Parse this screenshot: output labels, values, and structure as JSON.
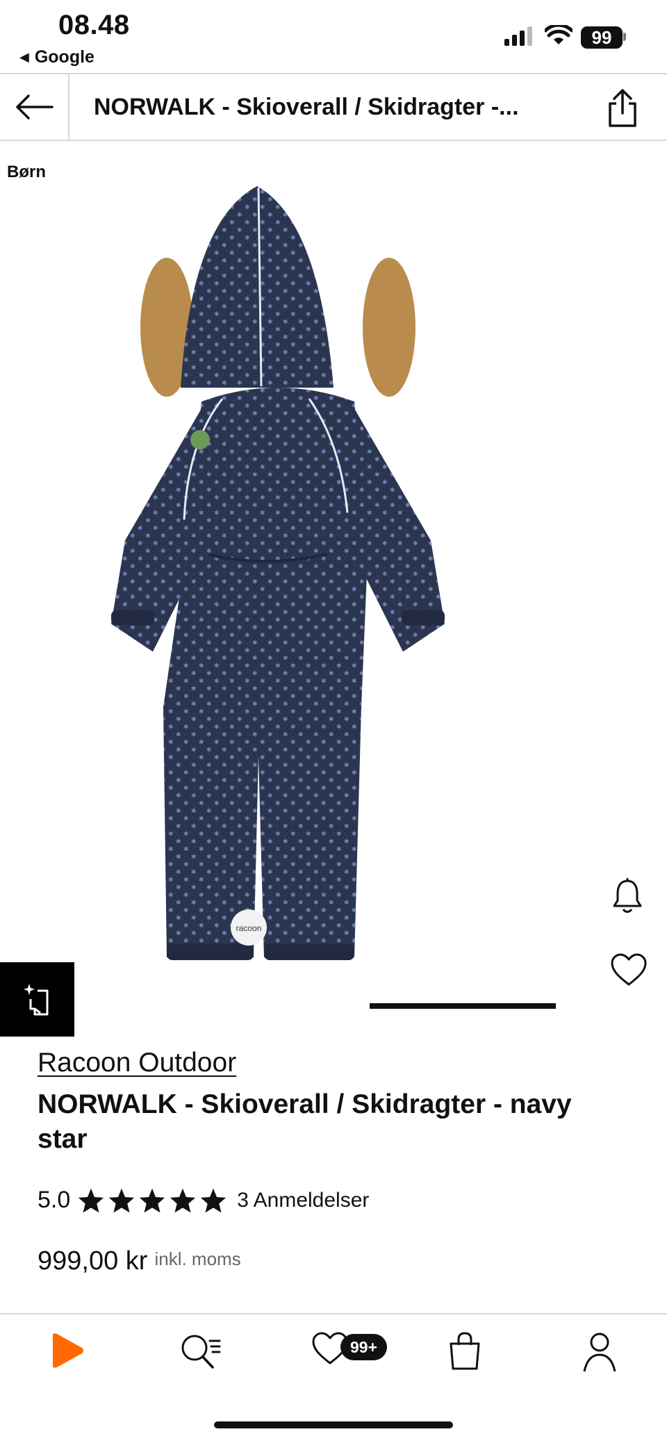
{
  "status_bar": {
    "time": "08.48",
    "back_app": "Google",
    "battery": "99"
  },
  "nav": {
    "title": "NORWALK - Skioverall / Skidragter -..."
  },
  "product": {
    "category_tag": "Børn",
    "brand": "Racoon Outdoor",
    "name": "NORWALK - Skioverall / Skidragter - navy star",
    "patch_text": "racoon",
    "rating": "5.0",
    "star_count": 5,
    "reviews": "3 Anmeldelser",
    "price": "999,00 kr",
    "vat_note": "inkl. moms",
    "color_hex": "#2c3550"
  },
  "tabbar": {
    "wishlist_badge": "99+",
    "accent": "#ff6900"
  }
}
